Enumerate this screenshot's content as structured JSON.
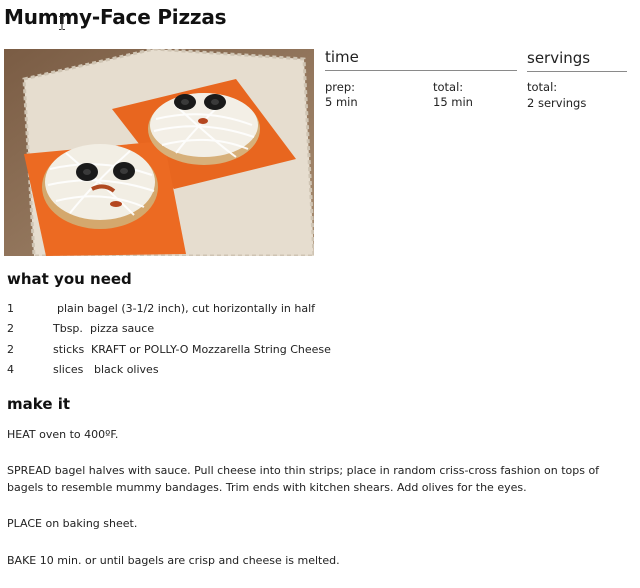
{
  "recipe": {
    "title": "Mummy-Face Pizzas"
  },
  "time": {
    "heading": "time",
    "prep_label": "prep:",
    "prep_value": "5 min",
    "total_label": "total:",
    "total_value": "15 min"
  },
  "servings": {
    "heading": "servings",
    "total_label": "total:",
    "total_value": "2 servings"
  },
  "need": {
    "heading": "what you need",
    "items": [
      {
        "qty": "1",
        "unit": "",
        "desc": "plain bagel (3-1/2 inch), cut horizontally in half"
      },
      {
        "qty": "2",
        "unit": "Tbsp.",
        "desc": "pizza sauce"
      },
      {
        "qty": "2",
        "unit": "sticks",
        "desc": "KRAFT or POLLY-O Mozzarella String Cheese"
      },
      {
        "qty": "4",
        "unit": "slices",
        "desc": "black olives"
      }
    ]
  },
  "make": {
    "heading": "make it",
    "steps": [
      {
        "lead": "HEAT",
        "text": " oven to 400ºF."
      },
      {
        "lead": "SPREAD",
        "text": " bagel halves with sauce. Pull cheese into thin strips; place in random criss-cross fashion on tops of bagels to resemble mummy bandages. Trim ends with kitchen shears. Add olives for the eyes."
      },
      {
        "lead": "PLACE",
        "text": " on baking sheet."
      },
      {
        "lead": "BAKE",
        "text": " 10 min. or until bagels are crisp and cheese is melted."
      }
    ]
  }
}
